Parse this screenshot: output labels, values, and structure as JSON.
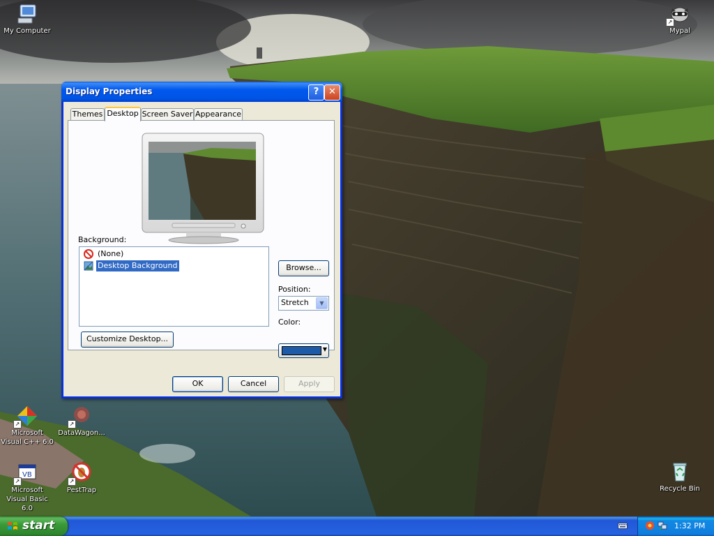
{
  "desktop": {
    "icons": [
      {
        "label": "My Computer"
      },
      {
        "label": "Mypal"
      },
      {
        "label": "Microsoft Visual C++ 6.0"
      },
      {
        "label": "DataWagon..."
      },
      {
        "label": "Microsoft Visual Basic 6.0"
      },
      {
        "label": "PestTrap"
      },
      {
        "label": "Recycle Bin"
      }
    ]
  },
  "dialog": {
    "title": "Display Properties",
    "help_glyph": "?",
    "close_glyph": "✕",
    "tabs": [
      {
        "label": "Themes"
      },
      {
        "label": "Desktop"
      },
      {
        "label": "Screen Saver"
      },
      {
        "label": "Appearance"
      }
    ],
    "active_tab": "Desktop",
    "background_label": "Background:",
    "background_items": [
      {
        "label": "(None)",
        "icon": "no-entry-icon"
      },
      {
        "label": "Desktop Background",
        "icon": "bitmap-icon"
      }
    ],
    "selected_background": "Desktop Background",
    "browse_label": "Browse...",
    "position_label": "Position:",
    "position_value": "Stretch",
    "color_label": "Color:",
    "color_value": "#1d5ba9",
    "customize_label": "Customize Desktop...",
    "ok_label": "OK",
    "cancel_label": "Cancel",
    "apply_label": "Apply"
  },
  "taskbar": {
    "start_label": "start",
    "clock": "1:32 PM"
  },
  "colors": {
    "titlebar": "#0054e3",
    "taskbar": "#245edb",
    "start": "#3a9a38",
    "dialog_bg": "#ece9d8",
    "selection": "#316ac5"
  }
}
